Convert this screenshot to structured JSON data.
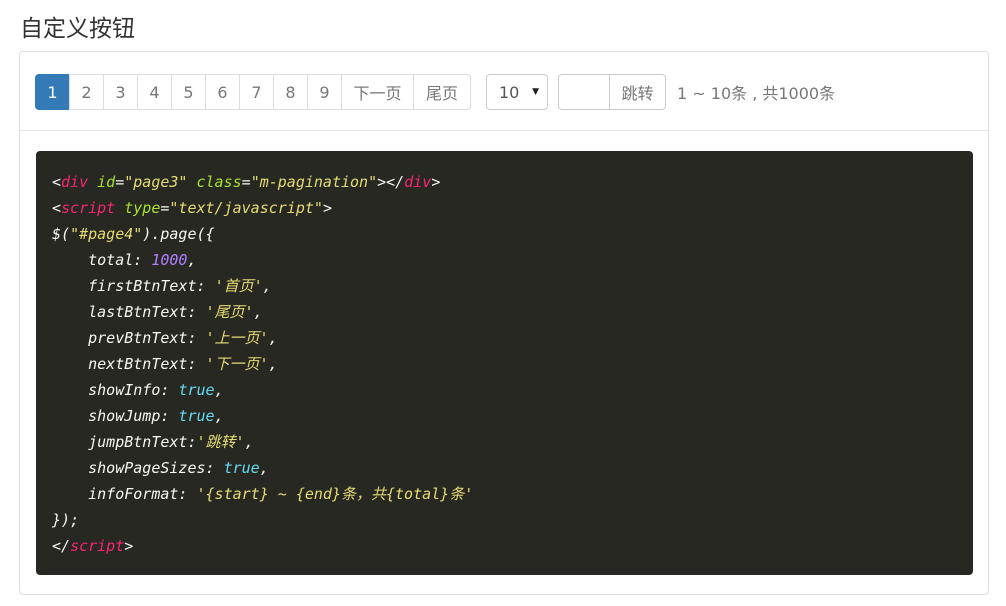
{
  "page_title": "自定义按钮",
  "pagination": {
    "pages": [
      "1",
      "2",
      "3",
      "4",
      "5",
      "6",
      "7",
      "8",
      "9"
    ],
    "active_page": "1",
    "next_label": "下一页",
    "last_label": "尾页"
  },
  "page_size": {
    "selected": "10"
  },
  "jump": {
    "input_value": "",
    "button_label": "跳转"
  },
  "info": "1 ~ 10条 , 共1000条",
  "colors": {
    "active": "#337ab7",
    "code_bg": "#272822",
    "tag": "#f92672",
    "attr": "#a6e22e",
    "string": "#e6db74",
    "number": "#ae81ff",
    "keyword": "#66d9ef"
  },
  "code": {
    "l1": {
      "a": "<",
      "b": "div",
      "c": " ",
      "d": "id",
      "e": "=",
      "f": "\"page3\"",
      "g": " ",
      "h": "class",
      "i": "=",
      "j": "\"m-pagination\"",
      "k": "></",
      "l": "div",
      "m": ">"
    },
    "l2": {
      "a": "<",
      "b": "script",
      "c": " ",
      "d": "type",
      "e": "=",
      "f": "\"text/javascript\"",
      "g": ">"
    },
    "l3": {
      "a": "$(",
      "b": "\"#page4\"",
      "c": ").page({"
    },
    "l4": {
      "a": "    total: ",
      "b": "1000",
      "c": ","
    },
    "l5": {
      "a": "    firstBtnText: ",
      "b": "'首页'",
      "c": ","
    },
    "l6": {
      "a": "    lastBtnText: ",
      "b": "'尾页'",
      "c": ","
    },
    "l7": {
      "a": "    prevBtnText: ",
      "b": "'上一页'",
      "c": ","
    },
    "l8": {
      "a": "    nextBtnText: ",
      "b": "'下一页'",
      "c": ","
    },
    "l9": {
      "a": "    showInfo: ",
      "b": "true",
      "c": ","
    },
    "l10": {
      "a": "    showJump: ",
      "b": "true",
      "c": ","
    },
    "l11": {
      "a": "    jumpBtnText:",
      "b": "'跳转'",
      "c": ","
    },
    "l12": {
      "a": "    showPageSizes: ",
      "b": "true",
      "c": ","
    },
    "l13": {
      "a": "    infoFormat: ",
      "b": "'{start} ~ {end}条，共{total}条'"
    },
    "l14": {
      "a": "});"
    },
    "l15": {
      "a": "</",
      "b": "script",
      "c": ">"
    }
  }
}
